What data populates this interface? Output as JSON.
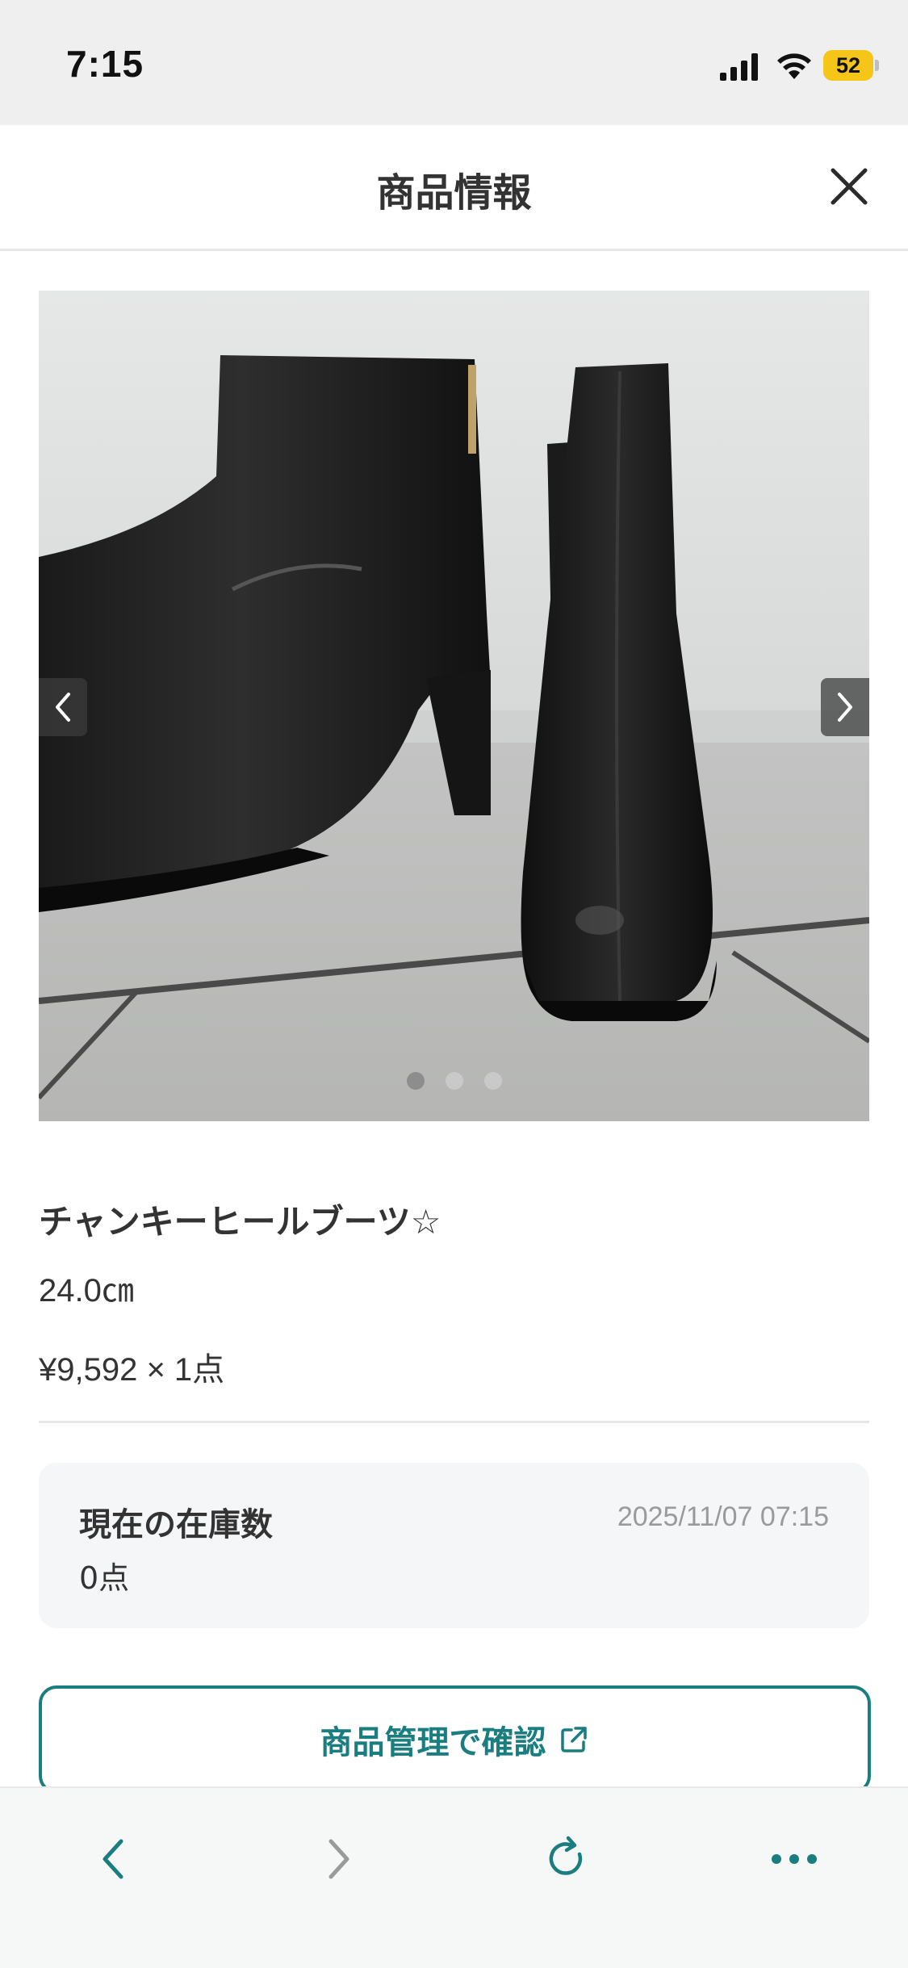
{
  "status_bar": {
    "time": "7:15",
    "battery_level": "52",
    "battery_color": "#f5c518"
  },
  "header": {
    "title": "商品情報",
    "close_icon": "close-icon"
  },
  "carousel": {
    "image_subject": "black heeled ankle boots photo",
    "dots_total": 3,
    "active_dot_index": 0
  },
  "product": {
    "name": "チャンキーヒールブーツ☆",
    "size": "24.0㎝",
    "price_quantity": "¥9,592 × 1点"
  },
  "stock": {
    "label": "現在の在庫数",
    "timestamp": "2025/11/07 07:15",
    "value": "0点"
  },
  "manage_button": {
    "label": "商品管理で確認",
    "icon": "external-link-icon"
  },
  "toolbar": {
    "back_icon": "chevron-left-icon",
    "forward_icon": "chevron-right-icon",
    "reload_icon": "reload-icon",
    "more_icon": "more-icon"
  },
  "colors": {
    "accent": "#1a7d80",
    "status_bar_bg": "#efefef",
    "card_bg": "#f5f6f8"
  }
}
